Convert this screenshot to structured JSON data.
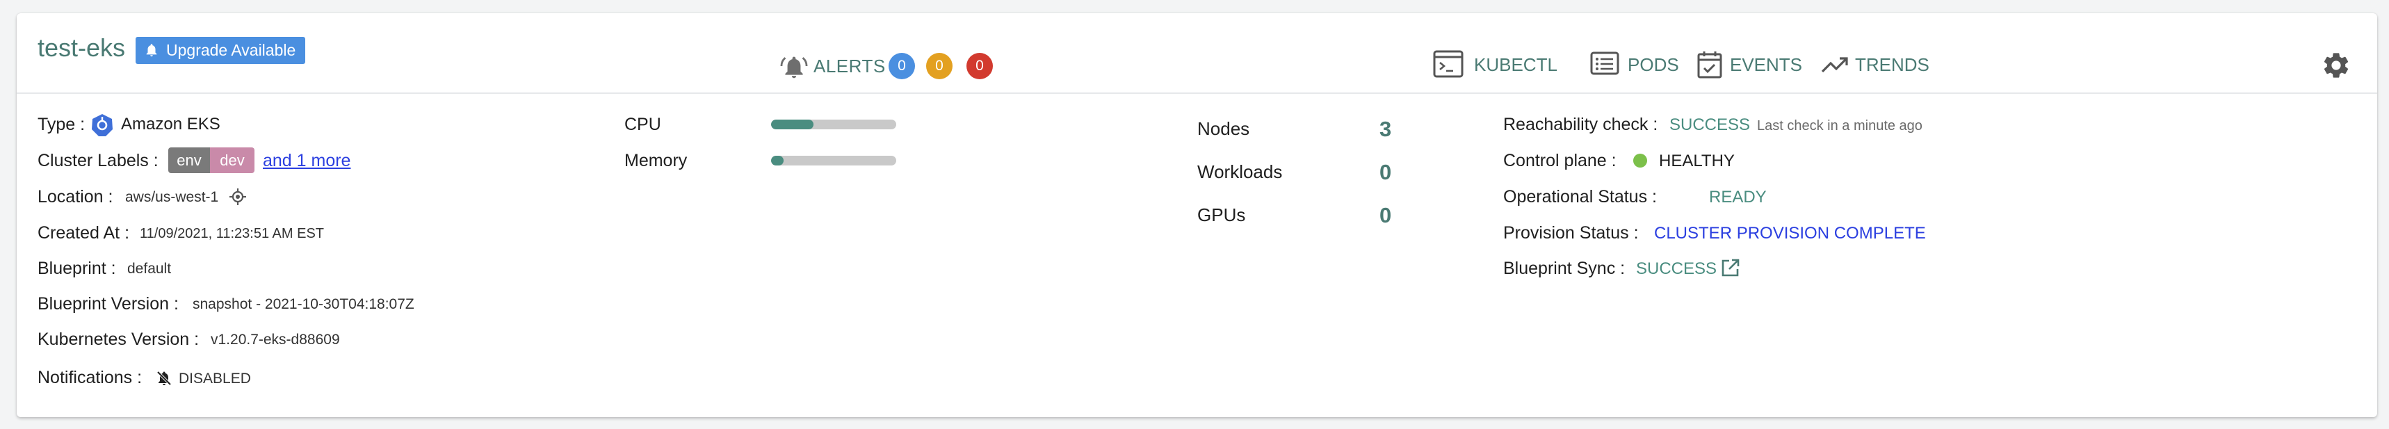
{
  "header": {
    "cluster_name": "test-eks",
    "upgrade_badge": "Upgrade Available",
    "alerts_label": "ALERTS",
    "alert_counts": [
      {
        "value": "0",
        "color": "#4a8fe0"
      },
      {
        "value": "0",
        "color": "#e3a020"
      },
      {
        "value": "0",
        "color": "#d23a2e"
      }
    ],
    "nav": {
      "kubectl": "KUBECTL",
      "pods": "PODS",
      "events": "EVENTS",
      "trends": "TRENDS"
    }
  },
  "details": {
    "type_label": "Type :",
    "type_value": "Amazon EKS",
    "cluster_labels_label": "Cluster Labels :",
    "label_key": "env",
    "label_value": "dev",
    "more_labels": "and 1 more",
    "location_label": "Location :",
    "location_value": "aws/us-west-1",
    "created_label": "Created At :",
    "created_value": "11/09/2021, 11:23:51 AM EST",
    "blueprint_label": "Blueprint :",
    "blueprint_value": "default",
    "blueprint_version_label": "Blueprint Version :",
    "blueprint_version_value": "snapshot - 2021-10-30T04:18:07Z",
    "k8s_version_label": "Kubernetes Version :",
    "k8s_version_value": "v1.20.7-eks-d88609",
    "notifications_label": "Notifications :",
    "notifications_value": "DISABLED"
  },
  "resources": {
    "cpu_label": "CPU",
    "cpu_fraction": 0.34,
    "memory_label": "Memory",
    "memory_fraction": 0.1
  },
  "stats": {
    "nodes_label": "Nodes",
    "nodes_value": "3",
    "workloads_label": "Workloads",
    "workloads_value": "0",
    "gpus_label": "GPUs",
    "gpus_value": "0"
  },
  "status": {
    "reachability_label": "Reachability check :",
    "reachability_value": "SUCCESS",
    "reachability_note": "Last check in a minute ago",
    "control_plane_label": "Control plane :",
    "control_plane_value": "HEALTHY",
    "operational_label": "Operational Status :",
    "operational_value": "READY",
    "provision_label": "Provision Status :",
    "provision_value": "CLUSTER PROVISION COMPLETE",
    "blueprint_sync_label": "Blueprint Sync :",
    "blueprint_sync_value": "SUCCESS"
  },
  "colors": {
    "accent": "#4a7a73",
    "link": "#2b3fe0",
    "healthy": "#7cc04a",
    "chip_key": "#7a7a7a",
    "chip_value": "#c98aa9"
  }
}
